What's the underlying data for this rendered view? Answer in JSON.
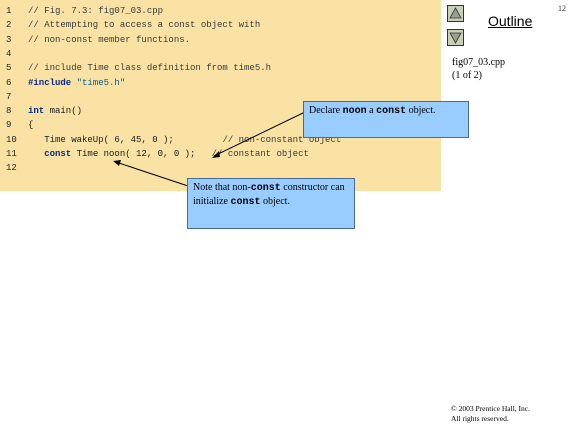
{
  "page_number": "12",
  "outline": {
    "title": "Outline",
    "file": "fig07_03.cpp",
    "part": "(1 of 2)"
  },
  "code_lines": [
    {
      "num": "1",
      "parts": [
        {
          "cls": "cmt",
          "text": "// Fig. 7.3: fig07_03.cpp"
        }
      ]
    },
    {
      "num": "2",
      "parts": [
        {
          "cls": "cmt",
          "text": "// Attempting to access a const object with"
        }
      ]
    },
    {
      "num": "3",
      "parts": [
        {
          "cls": "cmt",
          "text": "// non-const member functions."
        }
      ]
    },
    {
      "num": "4",
      "parts": []
    },
    {
      "num": "5",
      "parts": [
        {
          "cls": "cmt",
          "text": "// include Time class definition from time5.h"
        }
      ]
    },
    {
      "num": "6",
      "parts": [
        {
          "cls": "kw",
          "text": "#include"
        },
        {
          "cls": "",
          "text": " "
        },
        {
          "cls": "str",
          "text": "\"time5.h\""
        }
      ]
    },
    {
      "num": "7",
      "parts": []
    },
    {
      "num": "8",
      "parts": [
        {
          "cls": "kw",
          "text": "int"
        },
        {
          "cls": "",
          "text": " main()"
        }
      ]
    },
    {
      "num": "9",
      "parts": [
        {
          "cls": "",
          "text": "{"
        }
      ]
    },
    {
      "num": "10",
      "parts": [
        {
          "cls": "",
          "text": "   Time wakeUp( 6, 45, 0 );         "
        },
        {
          "cls": "cmt",
          "text": "// non-constant object"
        }
      ]
    },
    {
      "num": "11",
      "parts": [
        {
          "cls": "",
          "text": "   "
        },
        {
          "cls": "kw",
          "text": "const"
        },
        {
          "cls": "",
          "text": " Time noon( 12, 0, 0 );   "
        },
        {
          "cls": "cmt",
          "text": "// constant object"
        }
      ]
    },
    {
      "num": "12",
      "parts": []
    }
  ],
  "callout1": {
    "text1": "Declare ",
    "mono1": "noon",
    "text2": " a ",
    "mono2": "const",
    "text3": " object."
  },
  "callout2": {
    "text1": "Note that non-",
    "mono1": "const",
    "text2": " constructor can initialize ",
    "mono2": "const",
    "text3": " object."
  },
  "copyright": {
    "line1": "© 2003 Prentice Hall, Inc.",
    "line2": "All rights reserved."
  },
  "icons": {
    "up": "triangle-up-icon",
    "down": "triangle-down-icon"
  }
}
